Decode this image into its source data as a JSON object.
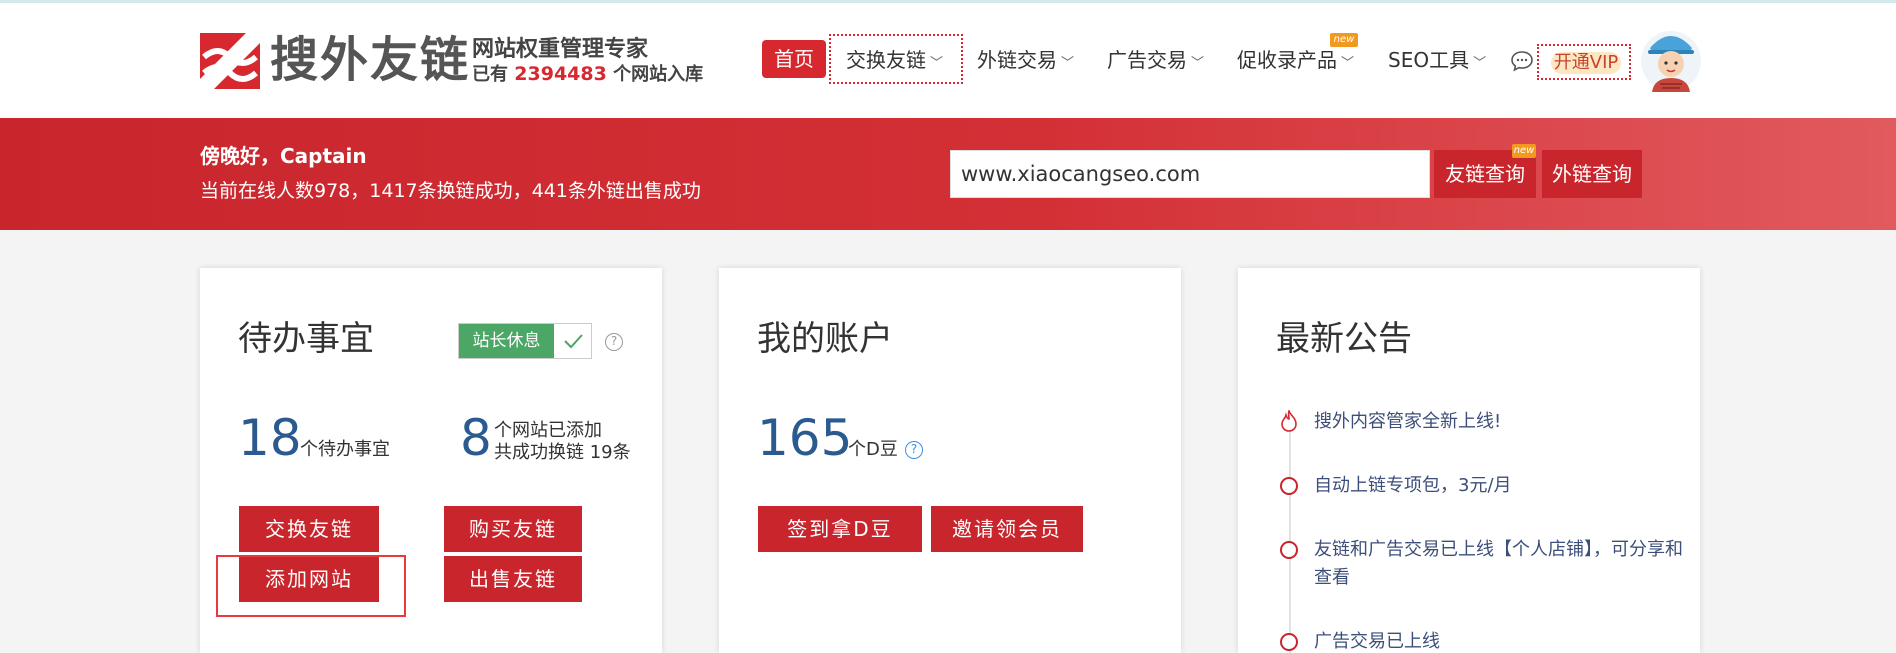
{
  "header": {
    "logo_name": "搜外友链",
    "slogan": "网站权重管理专家",
    "count_prefix": "已有",
    "count_value": "2394483",
    "count_suffix": "个网站入库",
    "nav": {
      "home": "首页",
      "exchange": "交换友链",
      "backlink_trade": "外链交易",
      "ad_trade": "广告交易",
      "index_products": "促收录产品",
      "seo_tools": "SEO工具",
      "new_badge": "new",
      "vip": "开通VIP"
    }
  },
  "banner": {
    "greeting": "傍晚好，Captain",
    "stats": "当前在线人数978，1417条换链成功，441条外链出售成功",
    "search_value": "www.xiaocangseo.com",
    "btn_friend_query": "友链查询",
    "btn_backlink_query": "外链查询",
    "new_badge": "new"
  },
  "todo": {
    "title": "待办事宜",
    "toggle_label": "站长休息",
    "pending_count": "18",
    "pending_label": "个待办事宜",
    "sites_count": "8",
    "sites_line1": "个网站已添加",
    "sites_line2": "共成功换链 19条",
    "btn_exchange": "交换友链",
    "btn_buy": "购买友链",
    "btn_add_site": "添加网站",
    "btn_sell": "出售友链"
  },
  "account": {
    "title": "我的账户",
    "balance": "165",
    "balance_unit": "个D豆",
    "btn_checkin": "签到拿D豆",
    "btn_invite": "邀请领会员"
  },
  "notices": {
    "title": "最新公告",
    "items": [
      "搜外内容管家全新上线!",
      "自动上链专项包，3元/月",
      "友链和广告交易已上线【个人店铺】，可分享和查看",
      "广告交易已上线"
    ]
  },
  "colors": {
    "brand_red": "#c9252d",
    "number_blue": "#2a5a90",
    "toggle_green": "#4ca665"
  }
}
